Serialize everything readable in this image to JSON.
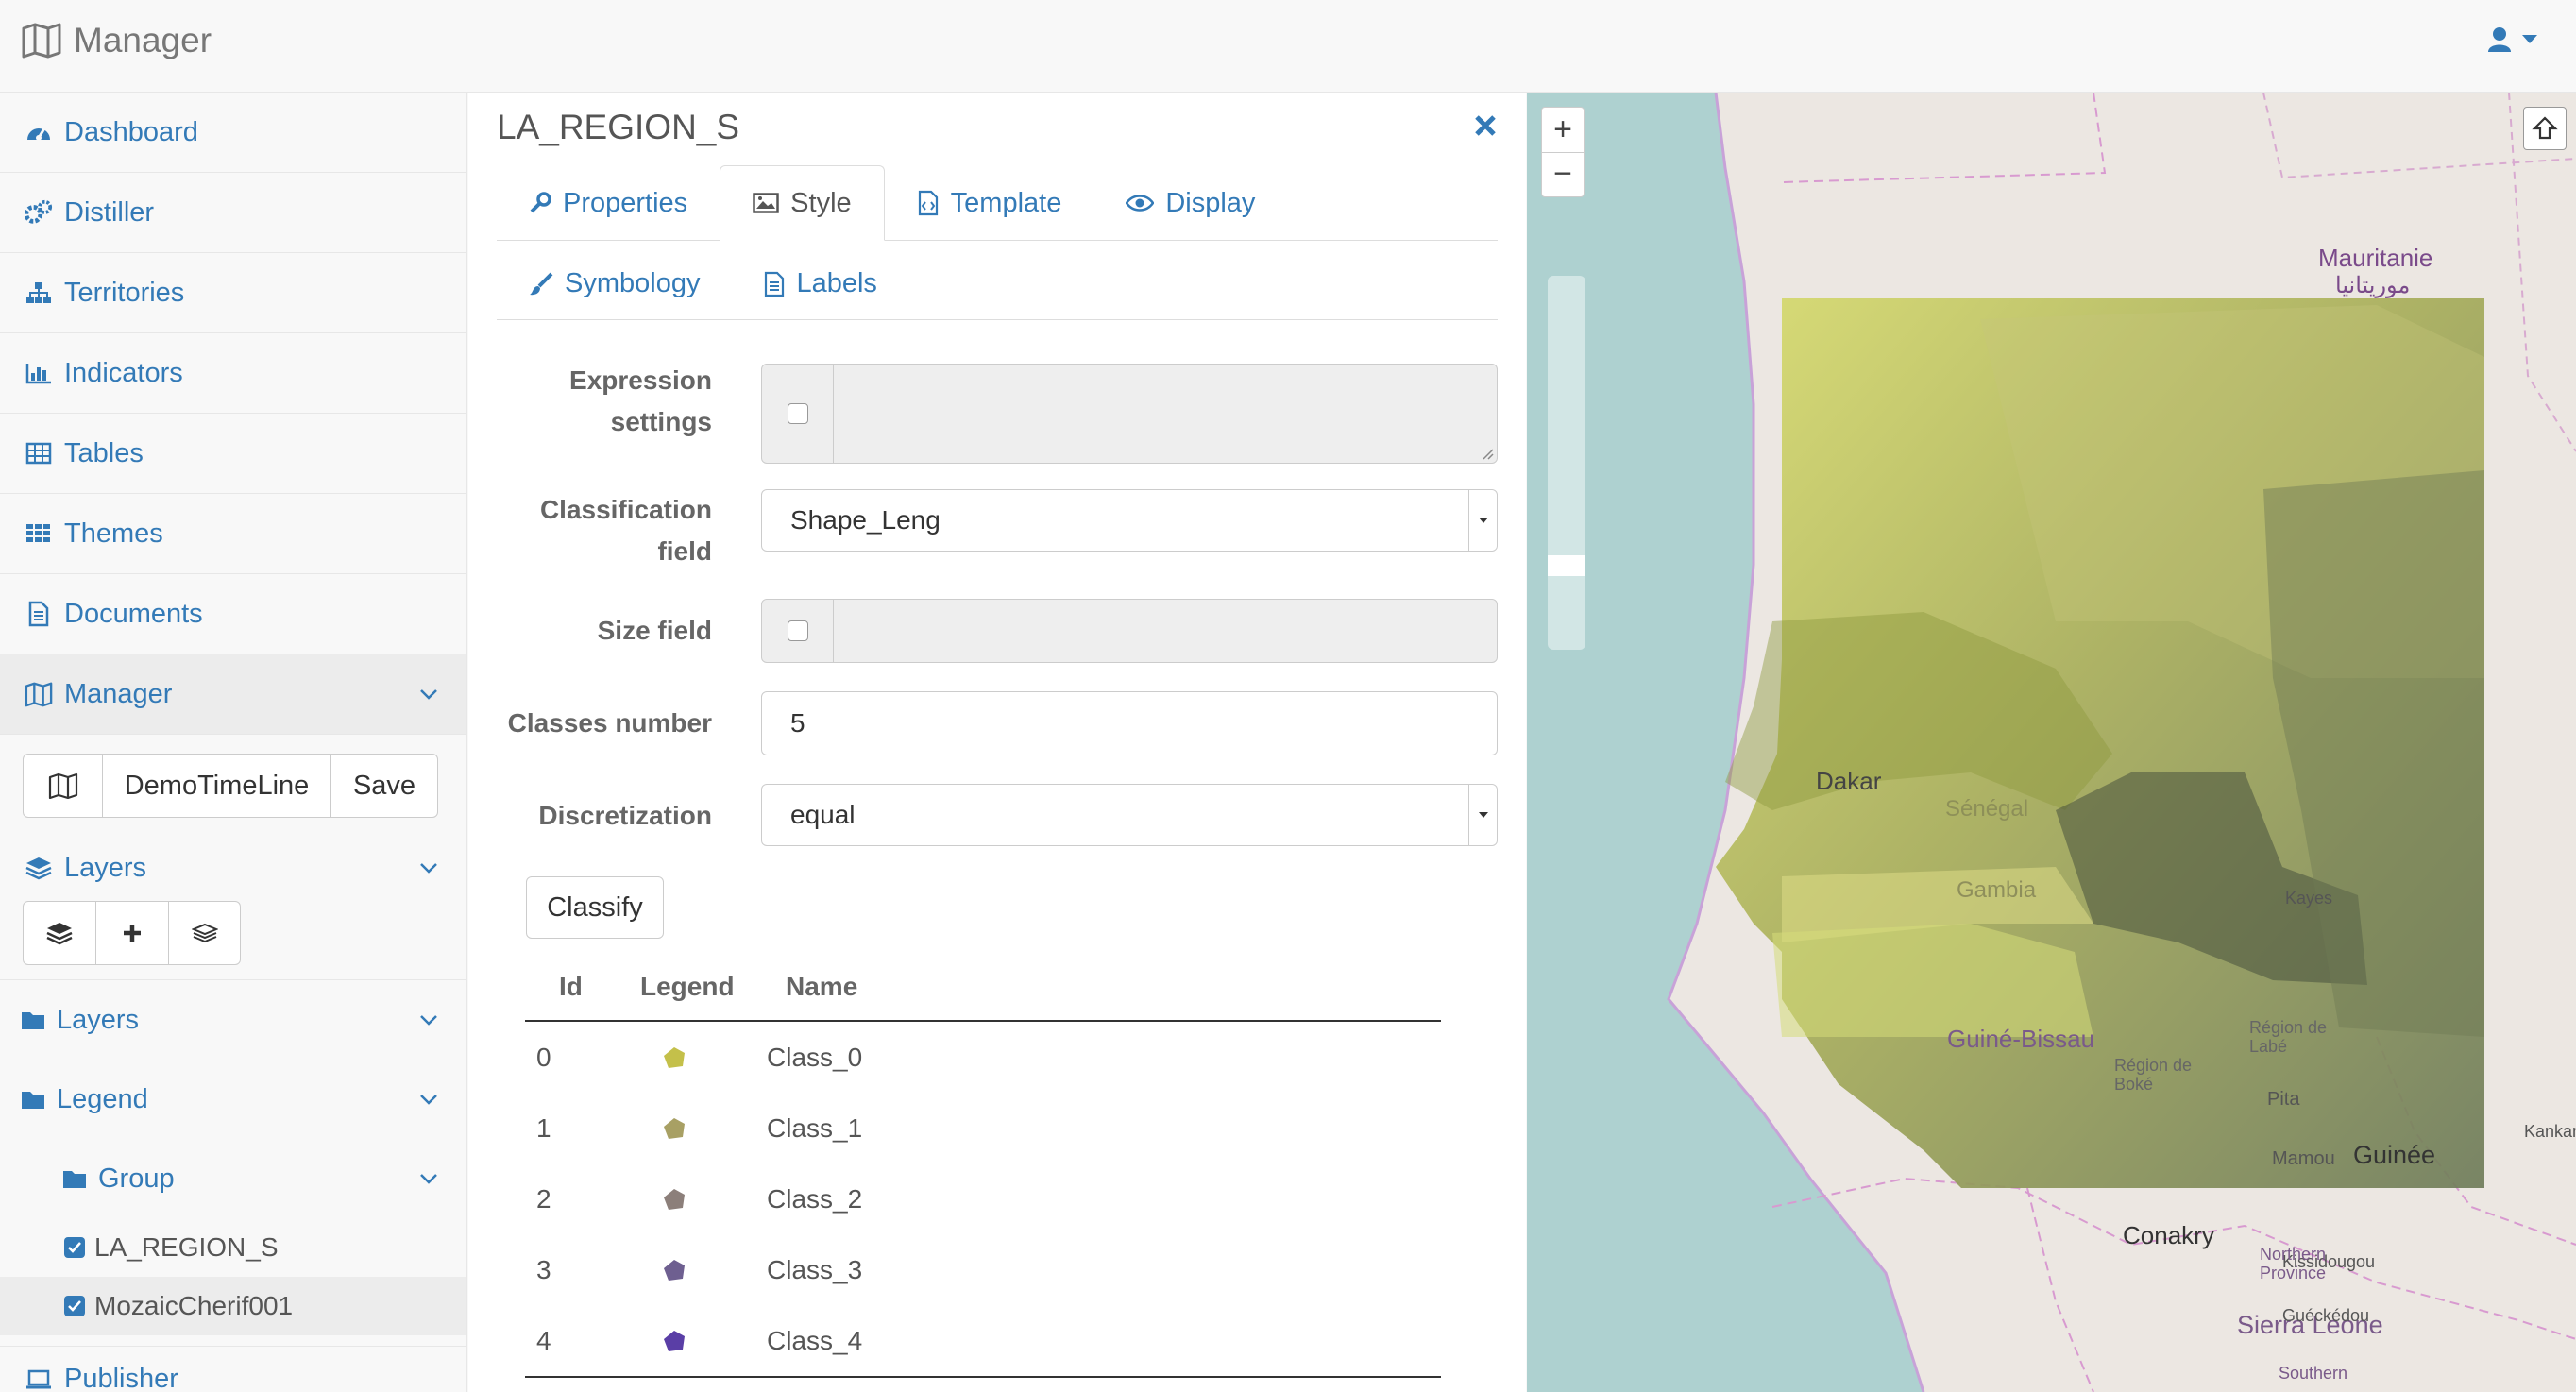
{
  "app": {
    "title": "Manager"
  },
  "sidebar": {
    "nav": [
      {
        "label": "Dashboard",
        "icon": "dashboard-icon"
      },
      {
        "label": "Distiller",
        "icon": "cogs-icon"
      },
      {
        "label": "Territories",
        "icon": "sitemap-icon"
      },
      {
        "label": "Indicators",
        "icon": "bar-chart-icon"
      },
      {
        "label": "Tables",
        "icon": "table-icon"
      },
      {
        "label": "Themes",
        "icon": "grid-icon"
      },
      {
        "label": "Documents",
        "icon": "document-icon"
      },
      {
        "label": "Manager",
        "icon": "map-icon"
      }
    ],
    "map_selector": {
      "name": "DemoTimeLine",
      "save_label": "Save"
    },
    "layers_header": "Layers",
    "tree": {
      "layers": "Layers",
      "legend": "Legend",
      "group": "Group",
      "items": [
        "LA_REGION_S",
        "MozaicCherif001"
      ]
    },
    "publisher": "Publisher"
  },
  "panel": {
    "title": "LA_REGION_S",
    "tabs": [
      "Properties",
      "Style",
      "Template",
      "Display"
    ],
    "active_tab": "Style",
    "subtabs": [
      "Symbology",
      "Labels"
    ],
    "form": {
      "expression_label_1": "Expression",
      "expression_label_2": "settings",
      "classification_label_1": "Classification",
      "classification_label_2": "field",
      "classification_value": "Shape_Leng",
      "size_label": "Size field",
      "classes_label": "Classes number",
      "classes_value": "5",
      "discretization_label": "Discretization",
      "discretization_value": "equal"
    },
    "classify_label": "Classify",
    "table": {
      "headers": [
        "Id",
        "Legend",
        "Name"
      ],
      "rows": [
        {
          "id": "0",
          "color": "#c4c04a",
          "name": "Class_0"
        },
        {
          "id": "1",
          "color": "#a8a064",
          "name": "Class_1"
        },
        {
          "id": "2",
          "color": "#8c7f7a",
          "name": "Class_2"
        },
        {
          "id": "3",
          "color": "#6e5f90",
          "name": "Class_3"
        },
        {
          "id": "4",
          "color": "#5a3ea6",
          "name": "Class_4"
        }
      ]
    }
  },
  "map": {
    "zoom_in": "+",
    "zoom_out": "−",
    "labels": {
      "mauritanie": "Mauritanie",
      "mauritanie_ar": "موريتانيا",
      "dakar": "Dakar",
      "guine_bissau": "Guiné-Bissau",
      "guinee": "Guinée",
      "conakry": "Conakry",
      "sierra_leone": "Sierra Leone",
      "gambia": "Gambia",
      "senegal": "Sénégal",
      "kayes": "Kayes",
      "kankan": "Kankan",
      "pita": "Pita",
      "mamou": "Mamou",
      "kissidougou": "Kissidougou",
      "gueckedou": "Guéckédou",
      "northern_province": "Northern Province",
      "southern_province": "Southern",
      "region_labe": "Région de Labé",
      "region_boke": "Région de Boké"
    }
  }
}
